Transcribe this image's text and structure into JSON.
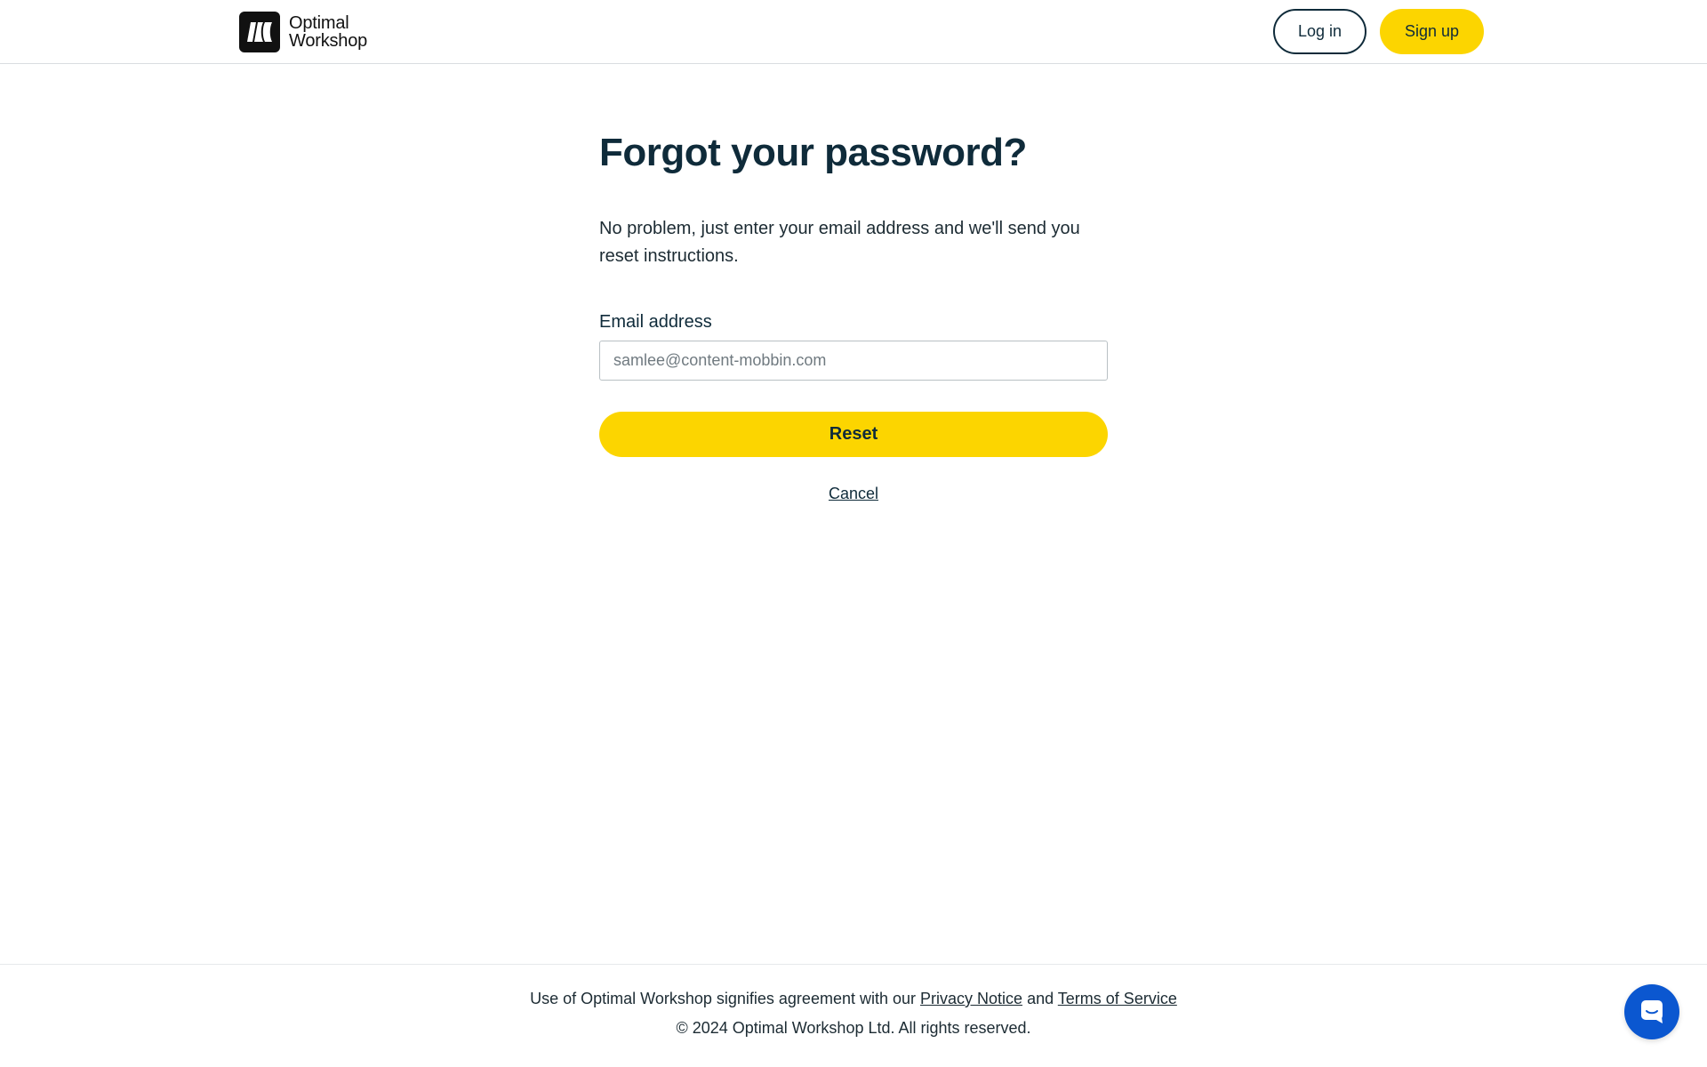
{
  "colors": {
    "brand_yellow": "#fcd500",
    "text_dark": "#0f2b3a",
    "chat_blue": "#0b57d0",
    "logo_black": "#111111"
  },
  "header": {
    "logo": {
      "icon": "optimal-workshop-logo-icon",
      "line1": "Optimal",
      "line2": "Workshop"
    },
    "login_label": "Log in",
    "signup_label": "Sign up"
  },
  "form": {
    "title": "Forgot your password?",
    "description": "No problem, just enter your email address and we'll send you reset instructions.",
    "email_label": "Email address",
    "email_placeholder": "samlee@content-mobbin.com",
    "email_value": "",
    "reset_label": "Reset",
    "cancel_label": "Cancel"
  },
  "footer": {
    "line1_prefix": "Use of Optimal Workshop signifies agreement with our",
    "privacy_label": "Privacy Notice",
    "and_text": "and",
    "terms_label": "Terms of Service",
    "copyright": "© 2024 Optimal Workshop Ltd. All rights reserved."
  },
  "chat": {
    "icon": "chat-icon"
  }
}
